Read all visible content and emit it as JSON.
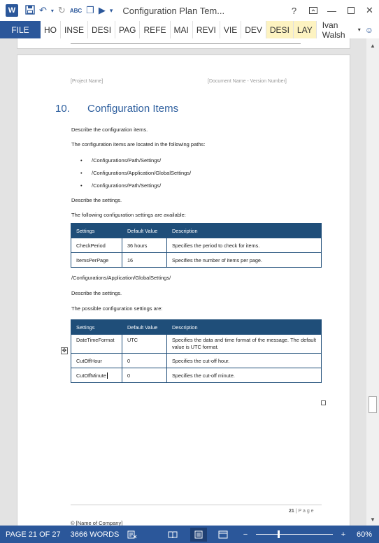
{
  "window": {
    "title": "Configuration Plan Tem...",
    "help": "?",
    "minimize": "—",
    "close": "✕"
  },
  "ribbon": {
    "file": "FILE",
    "tabs": [
      {
        "label": "HO",
        "highlight": false
      },
      {
        "label": "INSE",
        "highlight": false
      },
      {
        "label": "DESI",
        "highlight": false
      },
      {
        "label": "PAG",
        "highlight": false
      },
      {
        "label": "REFE",
        "highlight": false
      },
      {
        "label": "MAI",
        "highlight": false
      },
      {
        "label": "REVI",
        "highlight": false
      },
      {
        "label": "VIE",
        "highlight": false
      },
      {
        "label": "DEV",
        "highlight": false
      },
      {
        "label": "DESI",
        "highlight": true
      },
      {
        "label": "LAY",
        "highlight": true
      }
    ],
    "user": "Ivan Walsh"
  },
  "document": {
    "header_left": "[Project Name]",
    "header_right": "[Document Name - Version Number]",
    "heading_number": "10.",
    "heading_text": "Configuration Items",
    "p1": "Describe the configuration items.",
    "p2": "The configuration items are located in the following paths:",
    "bullets": [
      "/Configurations/Path/Settings/",
      "/Configurations/Application/GlobalSettings/",
      "/Configurations/Path/Settings/"
    ],
    "p3": "Describe the settings.",
    "p4": "The following configuration settings are available:",
    "table1": {
      "headers": [
        "Settings",
        "Default Value",
        "Description"
      ],
      "rows": [
        [
          "CheckPeriod",
          "36 hours",
          "Specifies the period to check for items."
        ],
        [
          "ItemsPerPage",
          "16",
          "Specifies the number of items per page."
        ]
      ]
    },
    "p5": "/Configurations/Application/GlobalSettings/",
    "p6": "Describe the settings.",
    "p7": "The possible configuration settings are:",
    "table2": {
      "headers": [
        "Settings",
        "Default Value",
        "Description"
      ],
      "rows": [
        [
          "DateTimeFormat",
          "UTC",
          "Specifies the data and time format of the message. The default value is UTC format."
        ],
        [
          "CutOffHour",
          "0",
          "Specifies the cut-off hour."
        ],
        [
          "CutOffMinute",
          "0",
          "Specifies the cut-off minute."
        ]
      ]
    },
    "footer_page_num": "21",
    "footer_page_label": " | P a g e",
    "footer_company": "© [Name of Company]"
  },
  "status": {
    "page": "PAGE 21 OF 27",
    "words": "3666 WORDS",
    "zoom": "60%",
    "zoom_level": 0.6
  }
}
